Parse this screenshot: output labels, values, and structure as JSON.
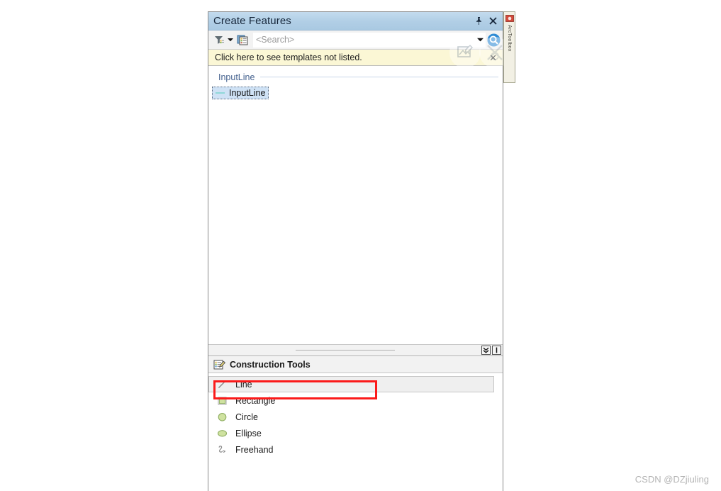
{
  "panel": {
    "title": "Create Features",
    "titlebar_buttons": [
      {
        "name": "pin-icon",
        "glyph": "⚑"
      },
      {
        "name": "close-icon",
        "glyph": "✕"
      }
    ],
    "toolbar": {
      "filter_icon": "filter-funnel-icon",
      "filter_caret_icon": "chevron-down-icon",
      "organize_templates_icon": "organize-templates-icon",
      "search_placeholder": "<Search>",
      "search_value": "",
      "search_caret_icon": "chevron-down-icon",
      "search_button_icon": "search-magnifier-icon",
      "ghost_edit_icon": "edit-watermark-icon",
      "ghost_cancel_icon": "cancel-watermark-icon"
    },
    "info_bar": {
      "text": "Click here to see templates not listed.",
      "close_glyph": "✕",
      "background": "#fbf7d5"
    },
    "template_list": {
      "groups": [
        {
          "label": "InputLine",
          "items": [
            {
              "label": "InputLine",
              "swatch_color": "#8fd8d8",
              "selected": true
            }
          ]
        }
      ]
    },
    "splitter": {
      "buttons": [
        {
          "name": "collapse-chevrons-button",
          "glyph": "»"
        },
        {
          "name": "divider-button",
          "glyph": "❘"
        }
      ]
    },
    "construction_tools": {
      "header": "Construction Tools",
      "header_icon": "list-pencil-icon",
      "items": [
        {
          "label": "Line",
          "icon": "line-tool-icon",
          "selected": true
        },
        {
          "label": "Rectangle",
          "icon": "rectangle-tool-icon",
          "selected": false
        },
        {
          "label": "Circle",
          "icon": "circle-tool-icon",
          "selected": false
        },
        {
          "label": "Ellipse",
          "icon": "ellipse-tool-icon",
          "selected": false
        },
        {
          "label": "Freehand",
          "icon": "freehand-tool-icon",
          "selected": false
        }
      ]
    },
    "annotation": {
      "name": "red-highlight-box",
      "color": "#fb1a1a",
      "targets": "Line"
    }
  },
  "vertical_tab": {
    "icon": "arctoolbox-icon",
    "label": "ArcToolbox"
  },
  "watermark": {
    "text": "CSDN @DZjiuling"
  }
}
